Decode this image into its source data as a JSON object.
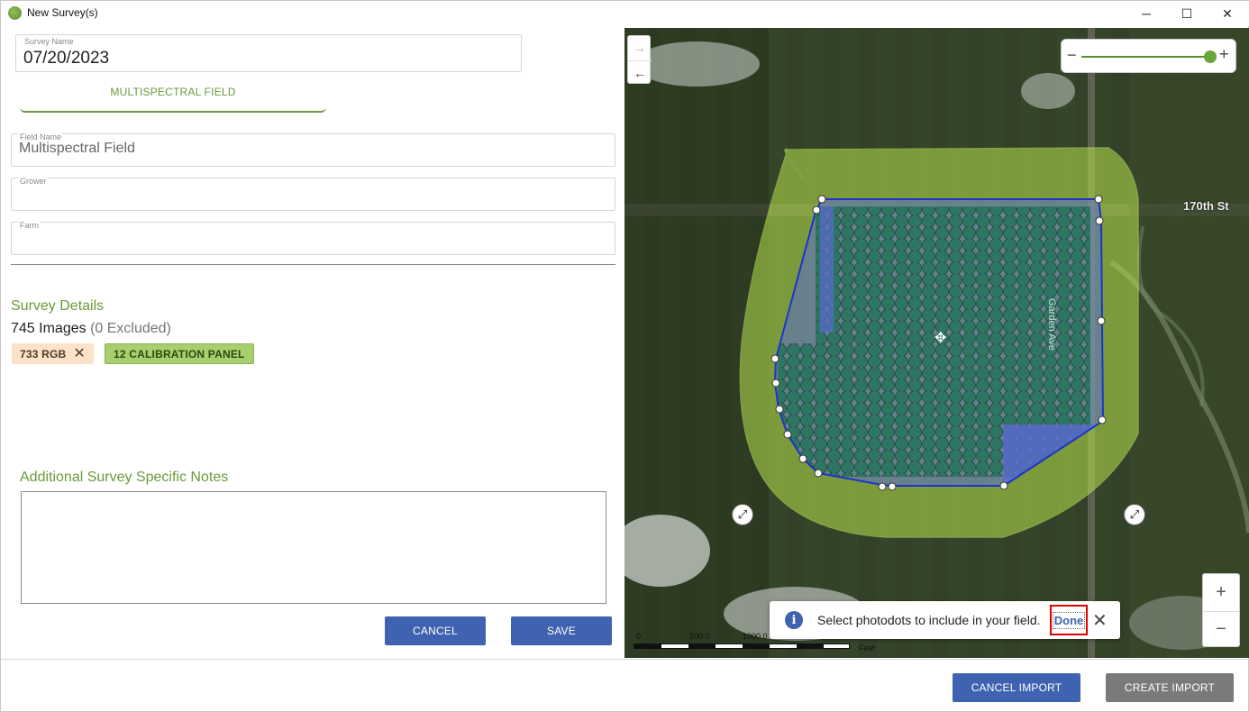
{
  "window": {
    "title": "New Survey(s)",
    "minimize": "─",
    "maximize": "☐",
    "close": "✕"
  },
  "form": {
    "survey_name": {
      "label": "Survey Name",
      "value": "07/20/2023"
    },
    "tab": {
      "label": "MULTISPECTRAL FIELD"
    },
    "field_name": {
      "label": "Field Name",
      "value": "Multispectral Field"
    },
    "grower": {
      "label": "Grower",
      "value": ""
    },
    "farm": {
      "label": "Farm",
      "value": ""
    }
  },
  "details": {
    "title": "Survey Details",
    "images_count": "745 Images",
    "excluded": "(0 Excluded)",
    "chips": [
      {
        "label": "733 RGB",
        "removable": true
      },
      {
        "label": "12 CALIBRATION PANEL",
        "removable": false
      }
    ],
    "remove_icon": "✕"
  },
  "notes": {
    "title": "Additional Survey Specific Notes",
    "value": ""
  },
  "buttons": {
    "cancel": "CANCEL",
    "save": "SAVE",
    "cancel_import": "CANCEL IMPORT",
    "create_import": "CREATE IMPORT"
  },
  "map": {
    "nav_forward": "→",
    "nav_back": "←",
    "slider_minus": "−",
    "slider_plus": "+",
    "slider_level": 1.0,
    "zoom_in": "+",
    "zoom_out": "−",
    "road_label": "170th St",
    "road_label2": "Garden Ave",
    "move_icon": "✥",
    "resize_icon": "⤢",
    "scale": {
      "labels": [
        "0",
        "500.0",
        "1000.0"
      ],
      "unit": "Feet"
    },
    "toast": {
      "info_icon": "i",
      "message": "Select photodots to include in your field.",
      "done": "Done",
      "close": "✕"
    }
  },
  "colors": {
    "accent_green": "#6b9a3a",
    "button_blue": "#3f63b0",
    "button_gray": "#7a7a7a",
    "polygon_fill": "#b6e34d",
    "polygon_stroke": "#1f34c8",
    "photodot": "#2e7563",
    "highlight_red": "#e00000"
  }
}
